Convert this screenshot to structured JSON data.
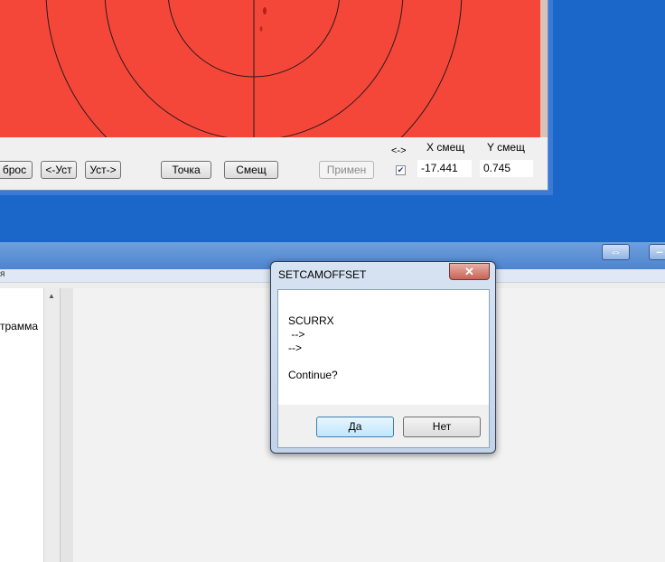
{
  "toolbar": {
    "reset_label": "брос",
    "prev_set_label": "<-Уст",
    "next_set_label": "Уст->",
    "point_label": "Точка",
    "offset_label": "Смещ",
    "apply_label": "Примен",
    "swap_label": "<->",
    "swap_checked": true,
    "x_offset_label": "X смещ",
    "y_offset_label": "Y смещ",
    "x_offset_value": "-17.441",
    "y_offset_value": "0.745"
  },
  "bottom_window": {
    "band_text": "я",
    "left_panel_text": "трамма"
  },
  "dialog": {
    "title": "SETCAMOFFSET",
    "lines": [
      "SCURRX",
      " -->",
      "-->",
      "",
      "Continue?"
    ],
    "yes_label": "Да",
    "no_label": "Нет"
  },
  "colors": {
    "desktop": "#1b67c9",
    "camera_background": "#f4473a",
    "reticle": "#2a1a1a"
  },
  "icons": {
    "close": "close-icon",
    "resize": "resize-arrows-icon",
    "minimize": "minimize-icon",
    "checkbox": "checkmark-icon",
    "scroll_up": "scroll-up-arrow-icon"
  }
}
